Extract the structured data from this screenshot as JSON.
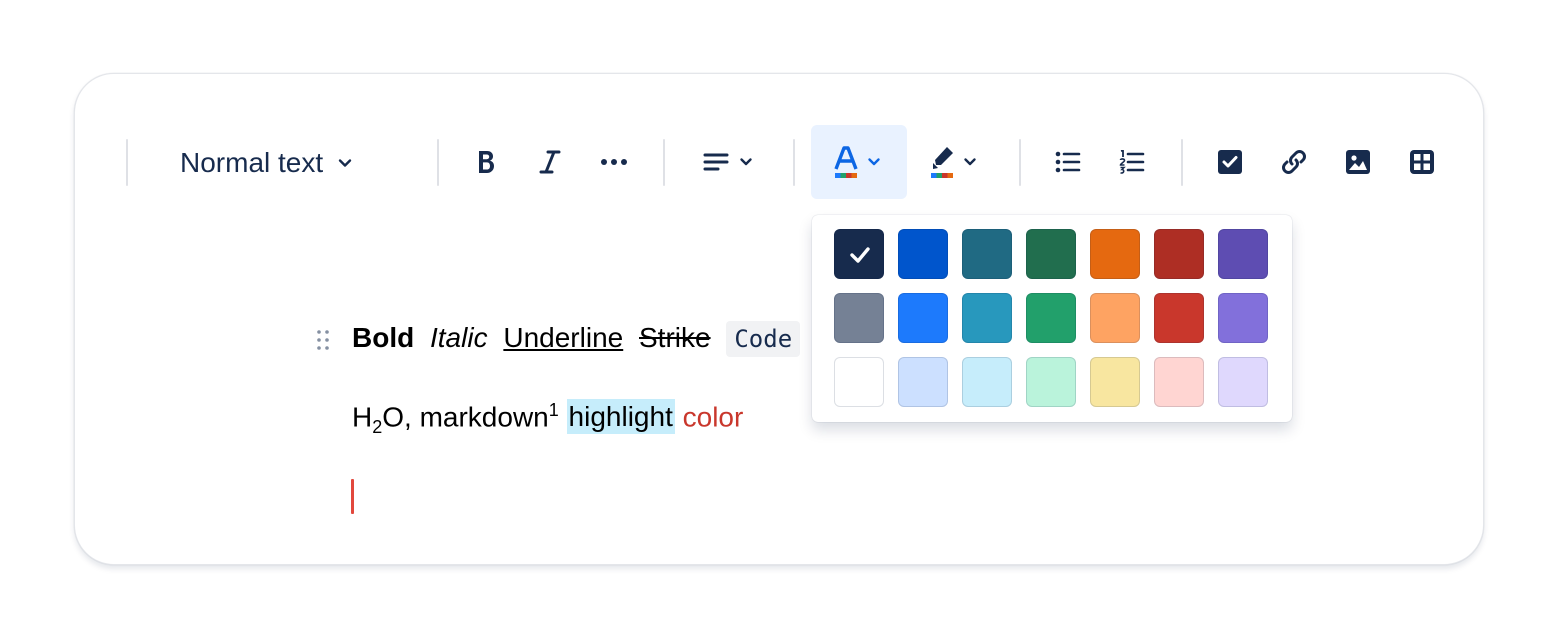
{
  "toolbar": {
    "text_style": "Normal text",
    "icons": {
      "text_style_chevron": "chevron-down-icon",
      "bold": "bold-icon",
      "italic": "italic-icon",
      "more": "more-formatting-icon",
      "align": "align-icon",
      "text_color": "text-color-icon",
      "highlight": "highlight-icon",
      "bullet_list": "bullet-list-icon",
      "numbered_list": "numbered-list-icon",
      "task": "task-checkbox-icon",
      "link": "link-icon",
      "image": "image-icon",
      "table": "table-icon"
    }
  },
  "color_palette": {
    "selected_index": 0,
    "rows": [
      [
        "#172b4d",
        "#0055cc",
        "#206a83",
        "#216e4e",
        "#e56910",
        "#ae2e24",
        "#5e4db2"
      ],
      [
        "#758195",
        "#1d7afc",
        "#2898bd",
        "#22a06b",
        "#fea362",
        "#c9372c",
        "#8270db"
      ],
      [
        "#ffffff",
        "#cce0ff",
        "#c6edfb",
        "#baf3db",
        "#f8e6a0",
        "#ffd5d2",
        "#dfd8fd"
      ]
    ]
  },
  "editor": {
    "line1": {
      "bold": "Bold",
      "italic": "Italic",
      "underline": "Underline",
      "strike": "Strike",
      "code": "Code"
    },
    "line2": {
      "h": "H",
      "sub": "2",
      "o_rest": "O, markdown",
      "sup": "1",
      "highlight": "highlight",
      "color": "color"
    }
  },
  "colors": {
    "text": "#172b4d",
    "accent": "#0c66e4",
    "highlight": "#c6edfb",
    "red_text": "#c9372c",
    "caret": "#e2483d"
  }
}
